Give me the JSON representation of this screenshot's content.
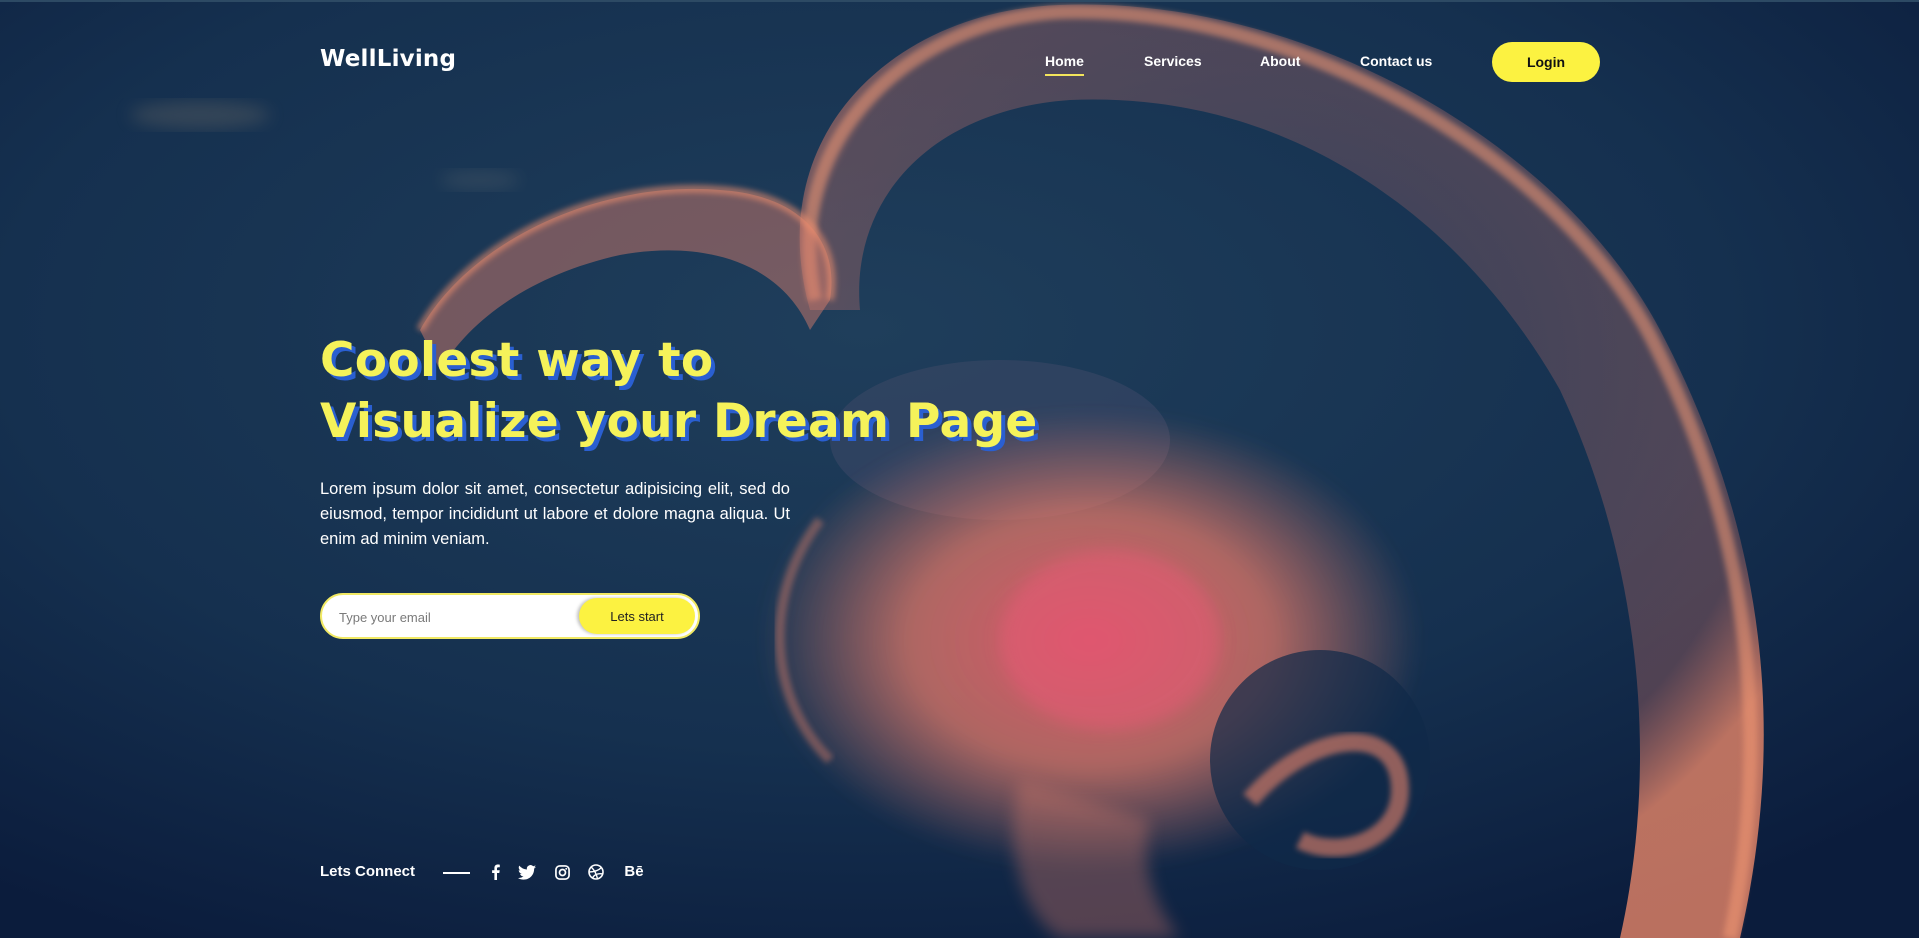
{
  "colors": {
    "accent": "#fcf241",
    "title_shadow": "#2a5fd1",
    "background": "#0f2546",
    "jellyfish": "#e8836a"
  },
  "brand": {
    "logo": "WellLiving"
  },
  "nav": {
    "items": [
      {
        "label": "Home",
        "active": true
      },
      {
        "label": "Services",
        "active": false
      },
      {
        "label": "About",
        "active": false
      },
      {
        "label": "Contact us",
        "active": false
      }
    ],
    "login": "Login"
  },
  "hero": {
    "title_line1": "Coolest way to",
    "title_line2": "Visualize your Dream Page",
    "text": "Lorem ipsum dolor sit amet, consectetur adipisicing elit, sed do eiusmod, tempor incididunt ut labore et dolore magna aliqua. Ut enim ad minim veniam."
  },
  "signup": {
    "email_placeholder": "Type your email",
    "email_value": "",
    "button": "Lets start"
  },
  "connect": {
    "label": "Lets Connect",
    "icons": [
      "facebook-icon",
      "twitter-icon",
      "instagram-icon",
      "dribbble-icon",
      "behance-icon"
    ],
    "behance_text": "Bē"
  }
}
